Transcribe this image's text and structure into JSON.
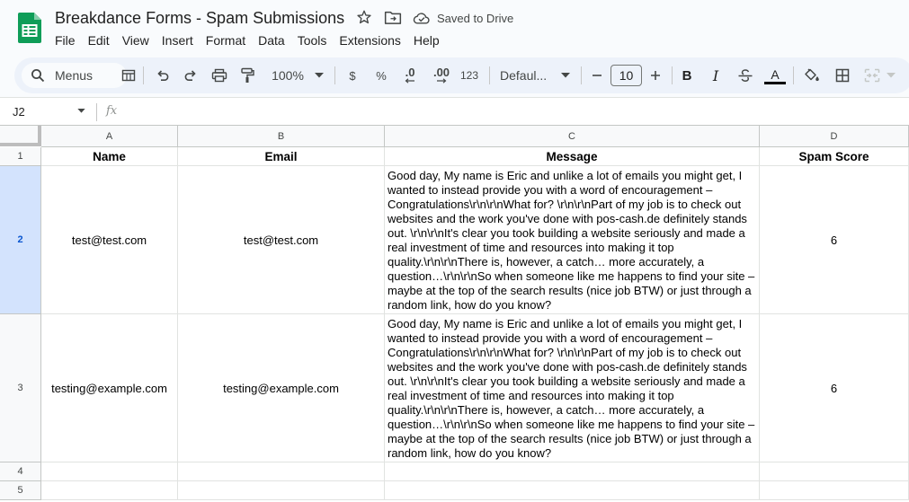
{
  "doc": {
    "title": "Breakdance Forms - Spam Submissions",
    "save_status": "Saved to Drive"
  },
  "menu": [
    "File",
    "Edit",
    "View",
    "Insert",
    "Format",
    "Data",
    "Tools",
    "Extensions",
    "Help"
  ],
  "toolbar": {
    "search_label": "Menus",
    "zoom": "100%",
    "currency": "$",
    "percent": "%",
    "decrease_decimal": ".0",
    "increase_decimal": ".00",
    "number_format": "123",
    "font": "Defaul...",
    "font_size": "10",
    "bold": "B",
    "italic": "I",
    "text_color": "A"
  },
  "formula_bar": {
    "cell_ref": "J2",
    "fx": "fx"
  },
  "grid": {
    "columns": [
      "A",
      "B",
      "C",
      "D"
    ],
    "rows": [
      "1",
      "2",
      "3",
      "4",
      "5"
    ],
    "header": [
      "Name",
      "Email",
      "Message",
      "Spam Score"
    ],
    "records": [
      {
        "name": "test@test.com",
        "email": "test@test.com",
        "message": "Good day, My name is Eric and unlike a lot of emails you might get, I wanted to instead provide you with a word of encouragement – Congratulations\\r\\n\\r\\nWhat for? \\r\\n\\r\\nPart of my job is to check out websites and the work you've done with pos-cash.de definitely stands out. \\r\\n\\r\\nIt's clear you took building a website seriously and made a real investment of time and resources into making it top quality.\\r\\n\\r\\nThere is, however, a catch… more accurately, a question…\\r\\n\\r\\nSo when someone like me happens to find your site – maybe at the top of the search results (nice job BTW) or just through a random link, how do you know?",
        "spam_score": "6"
      },
      {
        "name": "testing@example.com",
        "email": "testing@example.com",
        "message": "Good day, My name is Eric and unlike a lot of emails you might get, I wanted to instead provide you with a word of encouragement – Congratulations\\r\\n\\r\\nWhat for? \\r\\n\\r\\nPart of my job is to check out websites and the work you've done with pos-cash.de definitely stands out. \\r\\n\\r\\nIt's clear you took building a website seriously and made a real investment of time and resources into making it top quality.\\r\\n\\r\\nThere is, however, a catch… more accurately, a question…\\r\\n\\r\\nSo when someone like me happens to find your site – maybe at the top of the search results (nice job BTW) or just through a random link, how do you know?",
        "spam_score": "6"
      }
    ],
    "selected_row": "2"
  },
  "colors": {
    "app_bg": "#f9fbfd",
    "toolbar_bg": "#edf2fa",
    "sheets_green": "#0f9d58",
    "selected_row_bg": "#d3e3fd",
    "selected_row_text": "#0b57d0"
  },
  "icons": [
    "sheets-logo-icon",
    "star-icon",
    "move-to-folder-icon",
    "cloud-saved-icon",
    "search-icon",
    "table-icon",
    "undo-icon",
    "redo-icon",
    "print-icon",
    "paint-format-icon",
    "chevron-down-icon",
    "minus-icon",
    "plus-icon",
    "strikethrough-icon",
    "fill-color-icon",
    "borders-icon",
    "merge-cells-icon"
  ]
}
